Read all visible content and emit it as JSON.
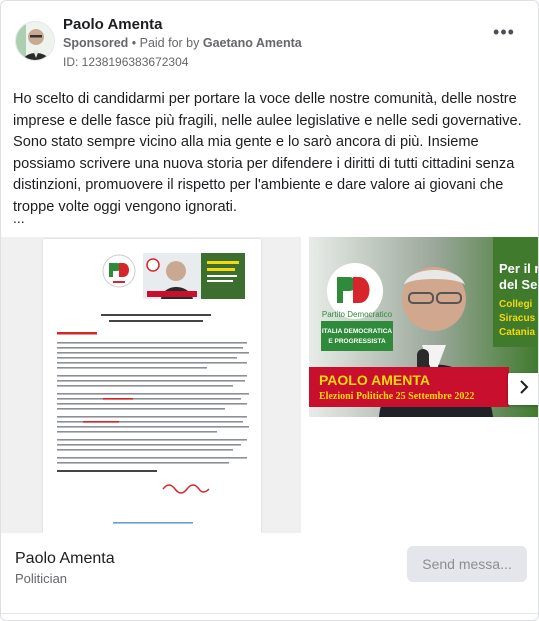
{
  "post": {
    "author": "Paolo Amenta",
    "sponsored_label": "Sponsored",
    "paid_for_prefix": " • Paid for by ",
    "paid_for_name": "Gaetano Amenta",
    "library_id": "ID: 1238196383672304",
    "more_icon": "more-horizontal-icon",
    "body": "Ho scelto di candidarmi per portare la voce delle nostre comunità, delle nostre imprese e delle fasce più fragili, nelle aulee legislative e nelle sedi governative. Sono stato sempre vicino alla mia gente e lo sarò ancora di più. Insieme possiamo scrivere una nuova storia per difendere i diritti di tutti cittadini senza distinzioni, promuovere il rispetto per l'ambiente e dare valore ai giovani che troppe volte oggi vengono ignorati.",
    "ellipsis": "..."
  },
  "carousel": {
    "slide1": {
      "party_logo_text": "PD",
      "doc_title": "ELEZIONI POLITICHE DEL 25 SETTEMBRE 2022",
      "doc_subtitle": "SENATO – COLLEGIO UNINOMINALE SIRACUSA - CATANIA",
      "salutation": "Carissimi Amici,",
      "closing": "GRAZIE, INSIEME POSSIAMO CRESCERE",
      "signature": "Paolo Amenta",
      "url": "https://www.facebook.com/paolo.amenta/"
    },
    "slide2": {
      "party_logo_text": "PD",
      "party_name": "Partito Democratico",
      "party_line2": "ITALIA DEMOCRATICA",
      "party_line3": "E PROGRESSISTA",
      "banner_name": "PAOLO AMENTA",
      "banner_sub": "Elezioni Politiche 25 Settembre 2022",
      "right_text1": "Per il r",
      "right_text2": "del Se",
      "right_text3": "Collegi",
      "right_text4": "Siracus",
      "right_text5": "Catania"
    },
    "next_icon": "chevron-right-icon"
  },
  "footer": {
    "page_name": "Paolo Amenta",
    "category": "Politician",
    "send_button": "Send messa..."
  },
  "colors": {
    "pd_green": "#2e8b3a",
    "pd_red": "#d7262b",
    "banner_red": "#c8102e",
    "banner_yellow": "#f5d90a"
  }
}
